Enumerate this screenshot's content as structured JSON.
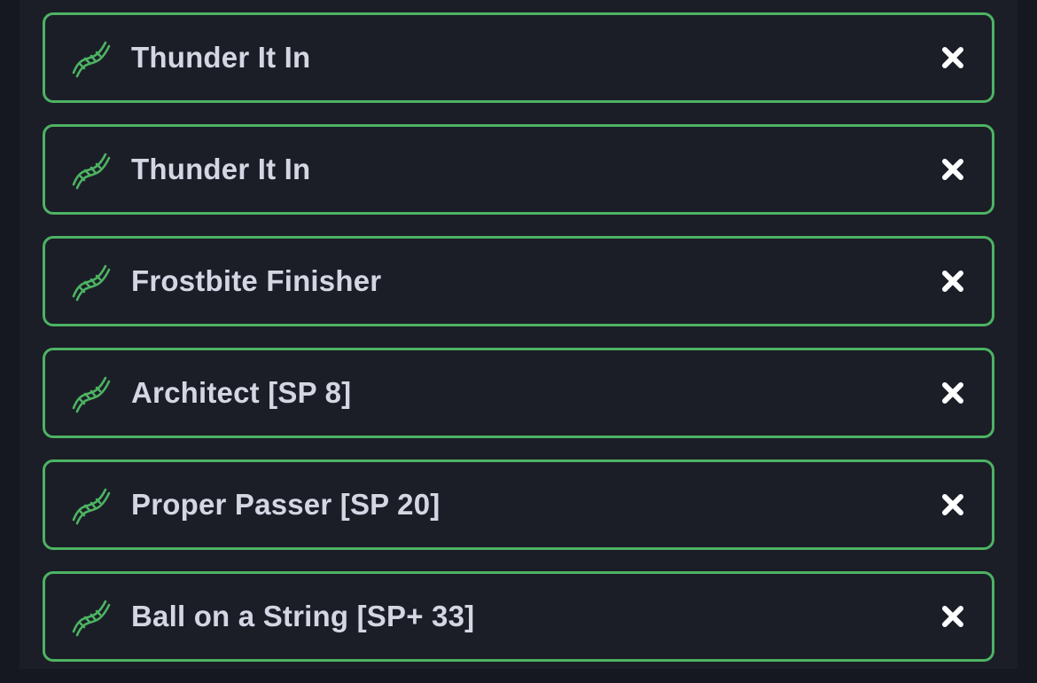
{
  "colors": {
    "background": "#151820",
    "panel": "#1b1e27",
    "accent_border": "#4db363",
    "icon_green": "#4db363",
    "text": "#d4d6e3",
    "close_icon": "#ffffff"
  },
  "items": [
    {
      "label": "Thunder It In",
      "icon": "dna-icon",
      "action_icon": "close-icon"
    },
    {
      "label": "Thunder It In",
      "icon": "dna-icon",
      "action_icon": "close-icon"
    },
    {
      "label": "Frostbite Finisher",
      "icon": "dna-icon",
      "action_icon": "close-icon"
    },
    {
      "label": "Architect [SP 8]",
      "icon": "dna-icon",
      "action_icon": "close-icon"
    },
    {
      "label": "Proper Passer [SP 20]",
      "icon": "dna-icon",
      "action_icon": "close-icon"
    },
    {
      "label": "Ball on a String [SP+ 33]",
      "icon": "dna-icon",
      "action_icon": "close-icon"
    }
  ]
}
